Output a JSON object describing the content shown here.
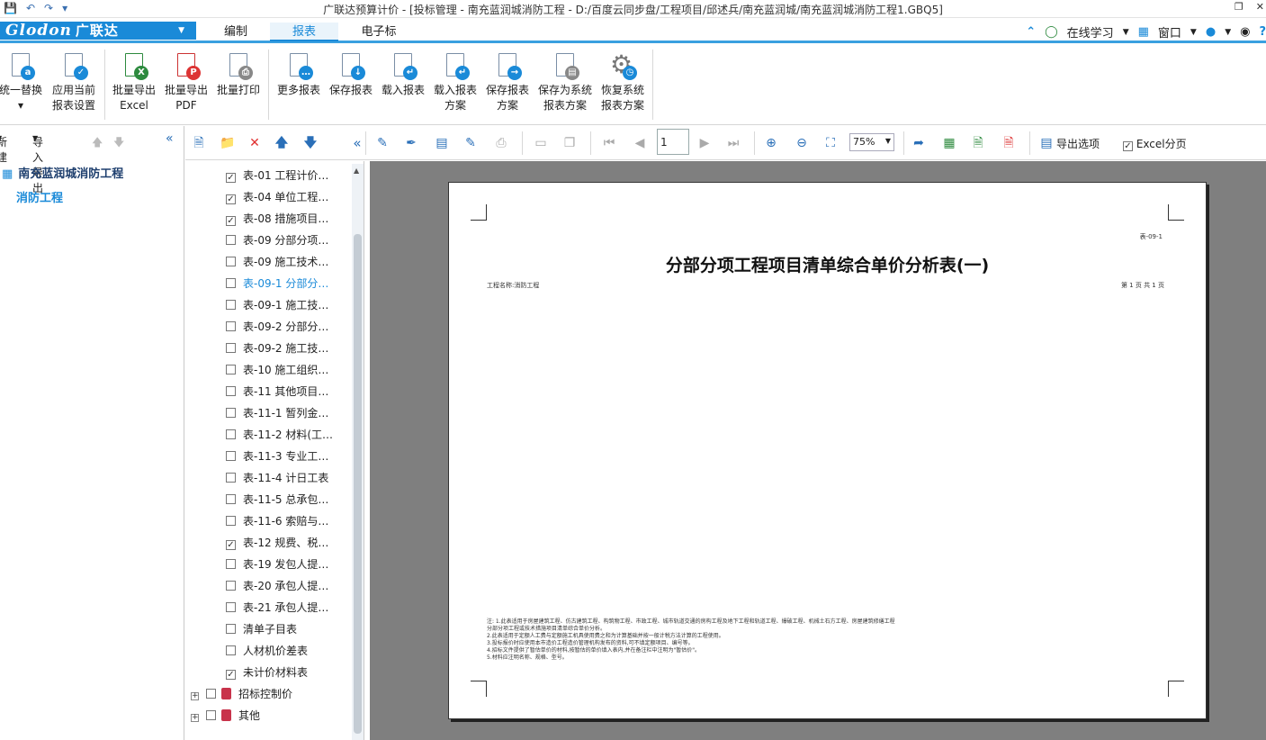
{
  "window": {
    "title": "广联达预算计价 - [投标管理 - 南充蓝润城消防工程 - D:/百度云同步盘/工程项目/邱述兵/南充蓝润城/南充蓝润城消防工程1.GBQ5]"
  },
  "menubar": {
    "logo_text": "Glodon",
    "logo_cn": "广联达",
    "tabs": [
      "编制",
      "报表",
      "电子标"
    ],
    "active_tab": "报表",
    "online_learning": "在线学习",
    "window_menu": "窗口"
  },
  "ribbon": {
    "unify_replace": [
      "统一替换",
      "▾"
    ],
    "apply_settings": [
      "应用当前",
      "报表设置"
    ],
    "export_excel": [
      "批量导出",
      "Excel"
    ],
    "export_pdf": [
      "批量导出",
      "PDF"
    ],
    "batch_print": "批量打印",
    "more_reports": "更多报表",
    "save_report": "保存报表",
    "load_report": "载入报表",
    "load_scheme": [
      "载入报表",
      "方案"
    ],
    "save_scheme": [
      "保存报表",
      "方案"
    ],
    "save_system_scheme": [
      "保存为系统",
      "报表方案"
    ],
    "restore_system_scheme": [
      "恢复系统",
      "报表方案"
    ]
  },
  "left_panel": {
    "new_label": "新建",
    "import_export_label": "导入导出",
    "tree_root": "南充蓝润城消防工程",
    "tree_child": "消防工程"
  },
  "toolbar": {
    "page_number": "1",
    "zoom": "75%",
    "export_options": "导出选项",
    "excel_paging": "Excel分页"
  },
  "reports": [
    {
      "label": "表-01 工程计价…",
      "checked": true
    },
    {
      "label": "表-04 单位工程…",
      "checked": true
    },
    {
      "label": "表-08 措施项目…",
      "checked": true
    },
    {
      "label": "表-09 分部分项…",
      "checked": false
    },
    {
      "label": "表-09 施工技术…",
      "checked": false
    },
    {
      "label": "表-09-1 分部分…",
      "checked": false,
      "highlighted": true
    },
    {
      "label": "表-09-1 施工技…",
      "checked": false
    },
    {
      "label": "表-09-2 分部分…",
      "checked": false
    },
    {
      "label": "表-09-2 施工技…",
      "checked": false
    },
    {
      "label": "表-10 施工组织…",
      "checked": false
    },
    {
      "label": "表-11 其他项目…",
      "checked": false
    },
    {
      "label": "表-11-1 暂列金…",
      "checked": false
    },
    {
      "label": "表-11-2 材料(工…",
      "checked": false
    },
    {
      "label": "表-11-3 专业工…",
      "checked": false
    },
    {
      "label": "表-11-4 计日工表",
      "checked": false
    },
    {
      "label": "表-11-5 总承包…",
      "checked": false
    },
    {
      "label": "表-11-6 索赔与…",
      "checked": false
    },
    {
      "label": "表-12 规费、税…",
      "checked": true
    },
    {
      "label": "表-19 发包人提…",
      "checked": false
    },
    {
      "label": "表-20 承包人提…",
      "checked": false
    },
    {
      "label": "表-21 承包人提…",
      "checked": false
    },
    {
      "label": "清单子目表",
      "checked": false
    },
    {
      "label": "人材机价差表",
      "checked": false
    },
    {
      "label": "未计价材料表",
      "checked": true
    }
  ],
  "report_groups": [
    {
      "label": "招标控制价"
    },
    {
      "label": "其他"
    }
  ],
  "preview": {
    "code": "表-09-1",
    "title": "分部分项工程项目清单综合单价分析表(一)",
    "project": "工程名称:消防工程",
    "page_info": "第 1 页  共 1 页",
    "notes": [
      "注: 1.此表适用于房屋建筑工程、仿古建筑工程、构筑物工程、市政工程、城市轨道交通的房构工程及地下工程和轨道工程、爆破工程、机械土石方工程、房屋建筑修缮工程",
      "      分部分项工程或技术措施项目清单综合单价分析。",
      "   2.此表适用于定额人工费与定额施工机具使用费之和为计算基础并按一般计税方法计算的工程使用。",
      "   3.投标报价时应使用本市造价工程造价管理机构发布的资料,可不填定额项目、编号等。",
      "   4.招标文件提供了暂估单价的材料,按暂估的单价填入表内,并在备注栏中注明为\"暂估价\"。",
      "   5.材料应注明名称、规格、型号。"
    ]
  },
  "colors": {
    "accent": "#1a8ad8",
    "delete": "#e03030",
    "preview_bg": "#7f7f7f"
  }
}
